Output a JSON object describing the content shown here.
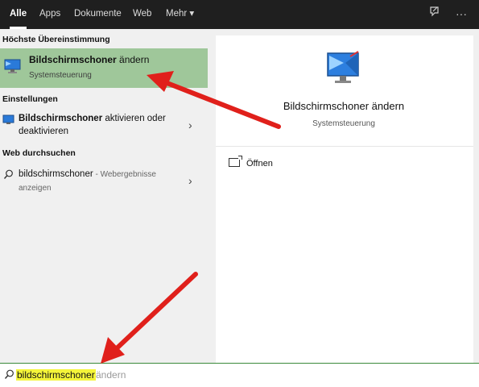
{
  "tabs": [
    {
      "label": "Alle",
      "active": true
    },
    {
      "label": "Apps"
    },
    {
      "label": "Dokumente"
    },
    {
      "label": "Web"
    },
    {
      "label": "Mehr ▾"
    }
  ],
  "toolbar_icons": [
    "feedback-icon",
    "more-icon"
  ],
  "sections": {
    "best_match": "Höchste Übereinstimmung",
    "settings": "Einstellungen",
    "web": "Web durchsuchen"
  },
  "best_match": {
    "title_bold": "Bildschirmschoner",
    "title_rest": " ändern",
    "subtitle": "Systemsteuerung"
  },
  "settings_item": {
    "bold": "Bildschirmschoner",
    "rest_line1": " aktivieren oder",
    "line2": "deaktivieren"
  },
  "web_item": {
    "query": "bildschirmschoner",
    "suffix_line1": " - Webergebnisse",
    "line2": "anzeigen"
  },
  "preview": {
    "title": "Bildschirmschoner ändern",
    "subtitle": "Systemsteuerung",
    "open_label": "Öffnen"
  },
  "search": {
    "typed": "bildschirmschoner",
    "suggestion": "ändern"
  },
  "colors": {
    "topbar": "#1f1f1f",
    "highlight": "#9fc79a",
    "arrow": "#e0201b",
    "search_highlight": "#f4f43a"
  }
}
